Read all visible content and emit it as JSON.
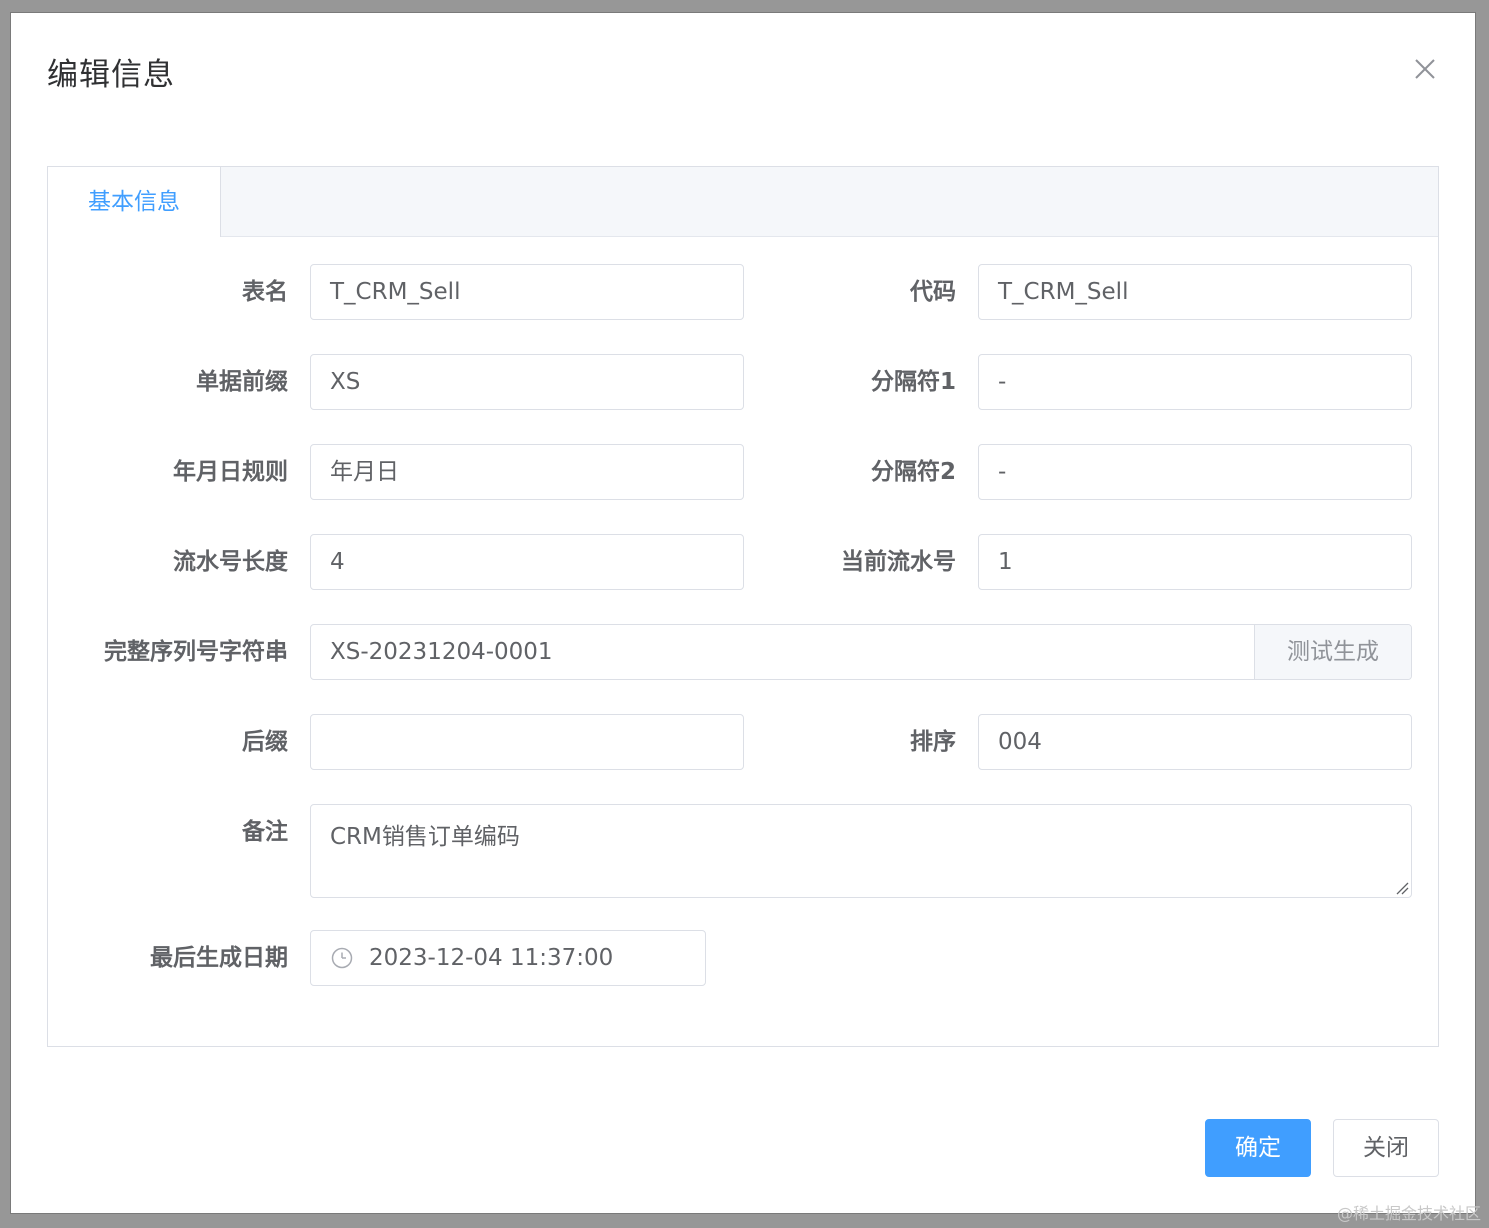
{
  "dialog": {
    "title": "编辑信息",
    "close_icon": "close-icon"
  },
  "tabs": [
    {
      "label": "基本信息",
      "active": true
    }
  ],
  "form": {
    "table_name": {
      "label": "表名",
      "value": "T_CRM_Sell"
    },
    "code": {
      "label": "代码",
      "value": "T_CRM_Sell"
    },
    "doc_prefix": {
      "label": "单据前缀",
      "value": "XS"
    },
    "separator1": {
      "label": "分隔符1",
      "value": "-"
    },
    "date_rule": {
      "label": "年月日规则",
      "value": "年月日"
    },
    "separator2": {
      "label": "分隔符2",
      "value": "-"
    },
    "serial_length": {
      "label": "流水号长度",
      "value": "4"
    },
    "current_serial": {
      "label": "当前流水号",
      "value": "1"
    },
    "full_serial": {
      "label": "完整序列号字符串",
      "value": "XS-20231204-0001",
      "button_label": "测试生成"
    },
    "suffix": {
      "label": "后缀",
      "value": ""
    },
    "sort": {
      "label": "排序",
      "value": "004"
    },
    "remark": {
      "label": "备注",
      "value": "CRM销售订单编码"
    },
    "last_generated": {
      "label": "最后生成日期",
      "value": "2023-12-04 11:37:00",
      "icon": "clock-icon"
    }
  },
  "footer": {
    "confirm_label": "确定",
    "close_label": "关闭"
  },
  "watermark": "@稀土掘金技术社区",
  "colors": {
    "primary": "#409eff",
    "border": "#dcdfe6",
    "text": "#606266",
    "title": "#303133"
  }
}
